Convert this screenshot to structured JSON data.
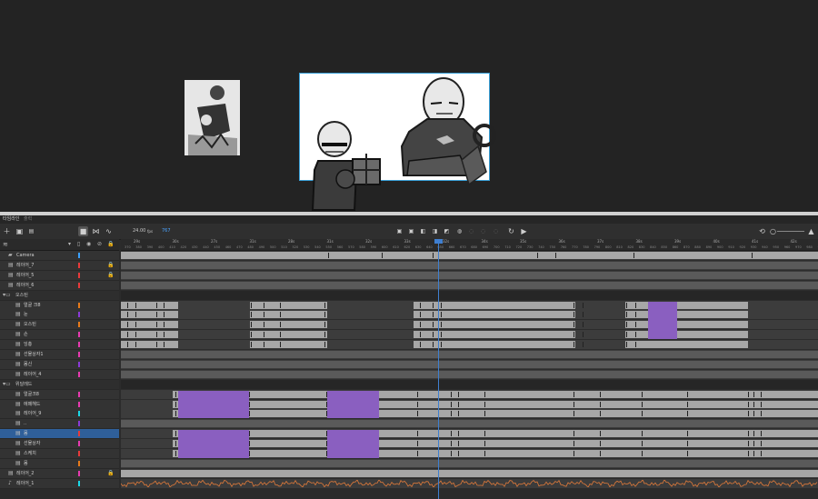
{
  "panel": {
    "tabs": [
      "타임라인",
      "출력"
    ],
    "fps": "24.00",
    "fps_unit": "fps",
    "current_frame": "767"
  },
  "ruler": {
    "seconds": [
      "29s",
      "30s",
      "27s",
      "31s",
      "28s",
      "31s",
      "32s",
      "33s",
      "32s",
      "34s",
      "35s",
      "36s",
      "37s",
      "38s",
      "39s",
      "40s",
      "41s",
      "42s"
    ],
    "frames": [
      "370",
      "380",
      "390",
      "400",
      "410",
      "420",
      "430",
      "440",
      "450",
      "460",
      "470",
      "480",
      "490",
      "500",
      "510",
      "520",
      "530",
      "540",
      "550",
      "560",
      "570",
      "580",
      "590",
      "600",
      "610",
      "620",
      "630",
      "640",
      "650",
      "660",
      "670",
      "680",
      "690",
      "700",
      "710",
      "720",
      "730",
      "740",
      "750",
      "760",
      "770",
      "780",
      "790",
      "800",
      "810",
      "820",
      "830",
      "840",
      "850",
      "860",
      "870",
      "880",
      "890",
      "900",
      "910",
      "920",
      "930",
      "940",
      "950",
      "960",
      "970",
      "980",
      "990"
    ]
  },
  "layers": [
    {
      "name": "Camera",
      "type": "camera",
      "color": "#3aa0ff",
      "lock": false,
      "indent": 0
    },
    {
      "name": "레이어_7",
      "type": "layer",
      "color": "#e83a3a",
      "lock": true,
      "indent": 0
    },
    {
      "name": "레이어_5",
      "type": "layer",
      "color": "#e83a3a",
      "lock": true,
      "indent": 0
    },
    {
      "name": "레이어_6",
      "type": "layer",
      "color": "#e83a3a",
      "lock": false,
      "indent": 0
    },
    {
      "name": "오스틴",
      "type": "folder",
      "color": "",
      "lock": false,
      "indent": 0
    },
    {
      "name": "얼굴 크8",
      "type": "layer",
      "color": "#e87a1a",
      "lock": false,
      "indent": 1
    },
    {
      "name": "눈",
      "type": "layer",
      "color": "#8a3ad8",
      "lock": false,
      "indent": 1
    },
    {
      "name": "오스틴",
      "type": "layer",
      "color": "#e87a1a",
      "lock": false,
      "indent": 1
    },
    {
      "name": "손",
      "type": "layer",
      "color": "#e83ab0",
      "lock": false,
      "indent": 1
    },
    {
      "name": "잉총",
      "type": "layer",
      "color": "#e83ab0",
      "lock": false,
      "indent": 1
    },
    {
      "name": "선물상자1",
      "type": "layer",
      "color": "#e83ab0",
      "lock": false,
      "indent": 1
    },
    {
      "name": "몸신",
      "type": "layer",
      "color": "#8a3ad8",
      "lock": false,
      "indent": 1
    },
    {
      "name": "레이어_4",
      "type": "layer",
      "color": "#e83ab0",
      "lock": false,
      "indent": 1
    },
    {
      "name": "위달레드",
      "type": "folder",
      "color": "",
      "lock": false,
      "indent": 0
    },
    {
      "name": "얼굴크8",
      "type": "layer",
      "color": "#e83ab0",
      "lock": false,
      "indent": 1
    },
    {
      "name": "에떼헤드",
      "type": "layer",
      "color": "#e83ab0",
      "lock": false,
      "indent": 1
    },
    {
      "name": "레이어_9",
      "type": "layer",
      "color": "#1ad8e8",
      "lock": false,
      "indent": 1
    },
    {
      "name": "..",
      "type": "layer",
      "color": "#8a3ad8",
      "lock": false,
      "indent": 1
    },
    {
      "name": "몸",
      "type": "layer",
      "color": "#e83a3a",
      "lock": false,
      "indent": 1,
      "selected": true
    },
    {
      "name": "선물상자",
      "type": "layer",
      "color": "#e83ab0",
      "lock": false,
      "indent": 1
    },
    {
      "name": "스케치",
      "type": "layer",
      "color": "#e83a3a",
      "lock": false,
      "indent": 1
    },
    {
      "name": "몸",
      "type": "layer",
      "color": "#e87a1a",
      "lock": false,
      "indent": 1
    },
    {
      "name": "레이어_2",
      "type": "layer",
      "color": "#e83ab0",
      "lock": true,
      "indent": 0
    },
    {
      "name": "레이어_1",
      "type": "audio",
      "color": "#1ad8e8",
      "lock": false,
      "indent": 0
    }
  ],
  "tracks": [
    {
      "segs": [
        {
          "k": "light",
          "s": 0,
          "e": 767
        }
      ],
      "kf": [
        228,
        287,
        343,
        458,
        478,
        564,
        694,
        781
      ]
    },
    {
      "segs": [
        {
          "k": "mid",
          "s": 0,
          "e": 767
        }
      ],
      "kf": []
    },
    {
      "segs": [
        {
          "k": "mid",
          "s": 0,
          "e": 767
        }
      ],
      "kf": []
    },
    {
      "segs": [
        {
          "k": "mid",
          "s": 0,
          "e": 767
        }
      ],
      "kf": []
    },
    {
      "segs": [],
      "kf": [],
      "folder": true
    },
    {
      "segs": [
        {
          "k": "light",
          "s": 0,
          "e": 63
        },
        {
          "k": "light",
          "s": 142,
          "e": 227
        },
        {
          "k": "light",
          "s": 322,
          "e": 500
        },
        {
          "k": "light",
          "s": 555,
          "e": 690
        }
      ],
      "kf": [
        7,
        16,
        39,
        47,
        143,
        157,
        175,
        224,
        329,
        343,
        352,
        498,
        508,
        556,
        566
      ]
    },
    {
      "segs": [
        {
          "k": "light",
          "s": 0,
          "e": 63
        },
        {
          "k": "light",
          "s": 142,
          "e": 227
        },
        {
          "k": "light",
          "s": 322,
          "e": 500
        },
        {
          "k": "light",
          "s": 555,
          "e": 690
        }
      ],
      "kf": [
        7,
        16,
        39,
        47,
        143,
        157,
        175,
        224,
        329,
        343,
        352,
        498,
        508,
        556,
        566
      ]
    },
    {
      "segs": [
        {
          "k": "light",
          "s": 0,
          "e": 63
        },
        {
          "k": "light",
          "s": 142,
          "e": 227
        },
        {
          "k": "light",
          "s": 322,
          "e": 500
        },
        {
          "k": "light",
          "s": 555,
          "e": 690
        }
      ],
      "kf": [
        7,
        16,
        39,
        47,
        143,
        157,
        175,
        224,
        329,
        343,
        352,
        498,
        508,
        556,
        566
      ]
    },
    {
      "segs": [
        {
          "k": "light",
          "s": 0,
          "e": 63
        },
        {
          "k": "light",
          "s": 142,
          "e": 227
        },
        {
          "k": "light",
          "s": 322,
          "e": 500
        },
        {
          "k": "light",
          "s": 555,
          "e": 690
        }
      ],
      "kf": [
        7,
        16,
        39,
        47,
        143,
        157,
        175,
        224,
        329,
        343,
        352,
        498,
        508,
        556,
        566
      ]
    },
    {
      "segs": [
        {
          "k": "light",
          "s": 0,
          "e": 63
        },
        {
          "k": "light",
          "s": 142,
          "e": 227
        },
        {
          "k": "light",
          "s": 322,
          "e": 500
        },
        {
          "k": "light",
          "s": 555,
          "e": 690
        }
      ],
      "kf": [
        7,
        16,
        39,
        47,
        143,
        157,
        175,
        224,
        329,
        343,
        352,
        498,
        508,
        556,
        566
      ]
    },
    {
      "segs": [
        {
          "k": "mid",
          "s": 0,
          "e": 767
        }
      ],
      "kf": []
    },
    {
      "segs": [
        {
          "k": "mid",
          "s": 0,
          "e": 767
        }
      ],
      "kf": []
    },
    {
      "segs": [
        {
          "k": "mid",
          "s": 0,
          "e": 767
        }
      ],
      "kf": []
    },
    {
      "segs": [],
      "kf": [],
      "folder": true
    },
    {
      "segs": [
        {
          "k": "light",
          "s": 57,
          "e": 767
        }
      ],
      "kf": [
        60,
        141,
        226,
        283,
        326,
        363,
        371,
        400,
        498,
        527,
        573,
        623,
        690,
        696,
        704
      ]
    },
    {
      "segs": [
        {
          "k": "light",
          "s": 57,
          "e": 767
        }
      ],
      "kf": [
        60,
        141,
        226,
        283,
        326,
        363,
        371,
        400,
        498,
        527,
        573,
        623,
        690,
        696,
        704
      ]
    },
    {
      "segs": [
        {
          "k": "light",
          "s": 57,
          "e": 767
        }
      ],
      "kf": [
        60,
        141,
        226,
        283,
        326,
        363,
        371,
        400,
        498,
        527,
        573,
        623,
        690,
        696,
        704
      ]
    },
    {
      "segs": [
        {
          "k": "mid",
          "s": 0,
          "e": 767
        }
      ],
      "kf": []
    },
    {
      "segs": [
        {
          "k": "light",
          "s": 57,
          "e": 767
        }
      ],
      "kf": [
        60,
        141,
        226,
        283,
        326,
        363,
        371,
        400,
        498,
        527,
        573,
        623,
        690,
        696,
        704
      ]
    },
    {
      "segs": [
        {
          "k": "light",
          "s": 57,
          "e": 767
        }
      ],
      "kf": [
        60,
        141,
        226,
        283,
        326,
        363,
        371,
        400,
        498,
        527,
        573,
        623,
        690,
        696,
        704
      ]
    },
    {
      "segs": [
        {
          "k": "light",
          "s": 57,
          "e": 767
        }
      ],
      "kf": [
        60,
        141,
        226,
        283,
        326,
        363,
        371,
        400,
        498,
        527,
        573,
        623,
        690,
        696,
        704
      ]
    },
    {
      "segs": [
        {
          "k": "mid",
          "s": 0,
          "e": 767
        }
      ],
      "kf": []
    },
    {
      "segs": [
        {
          "k": "light",
          "s": 0,
          "e": 767
        }
      ],
      "kf": []
    },
    {
      "segs": [],
      "kf": [],
      "audio": true
    }
  ],
  "purple_blocks": [
    {
      "row": 5,
      "s": 580,
      "e": 612,
      "rows": 4
    },
    {
      "row": 14,
      "s": 63,
      "e": 141,
      "rows": 3
    },
    {
      "row": 14,
      "s": 227,
      "e": 284,
      "rows": 3
    },
    {
      "row": 18,
      "s": 63,
      "e": 141,
      "rows": 3
    },
    {
      "row": 18,
      "s": 227,
      "e": 284,
      "rows": 3
    }
  ],
  "icons": {
    "new-layer": "＋",
    "folder": "▣",
    "delete": "🗑",
    "camera-view": "■",
    "graph": "⋈",
    "curve": "∿",
    "first": "⏮",
    "prev": "◀",
    "play": "▶",
    "loop": "⟲",
    "zoom": "○"
  }
}
